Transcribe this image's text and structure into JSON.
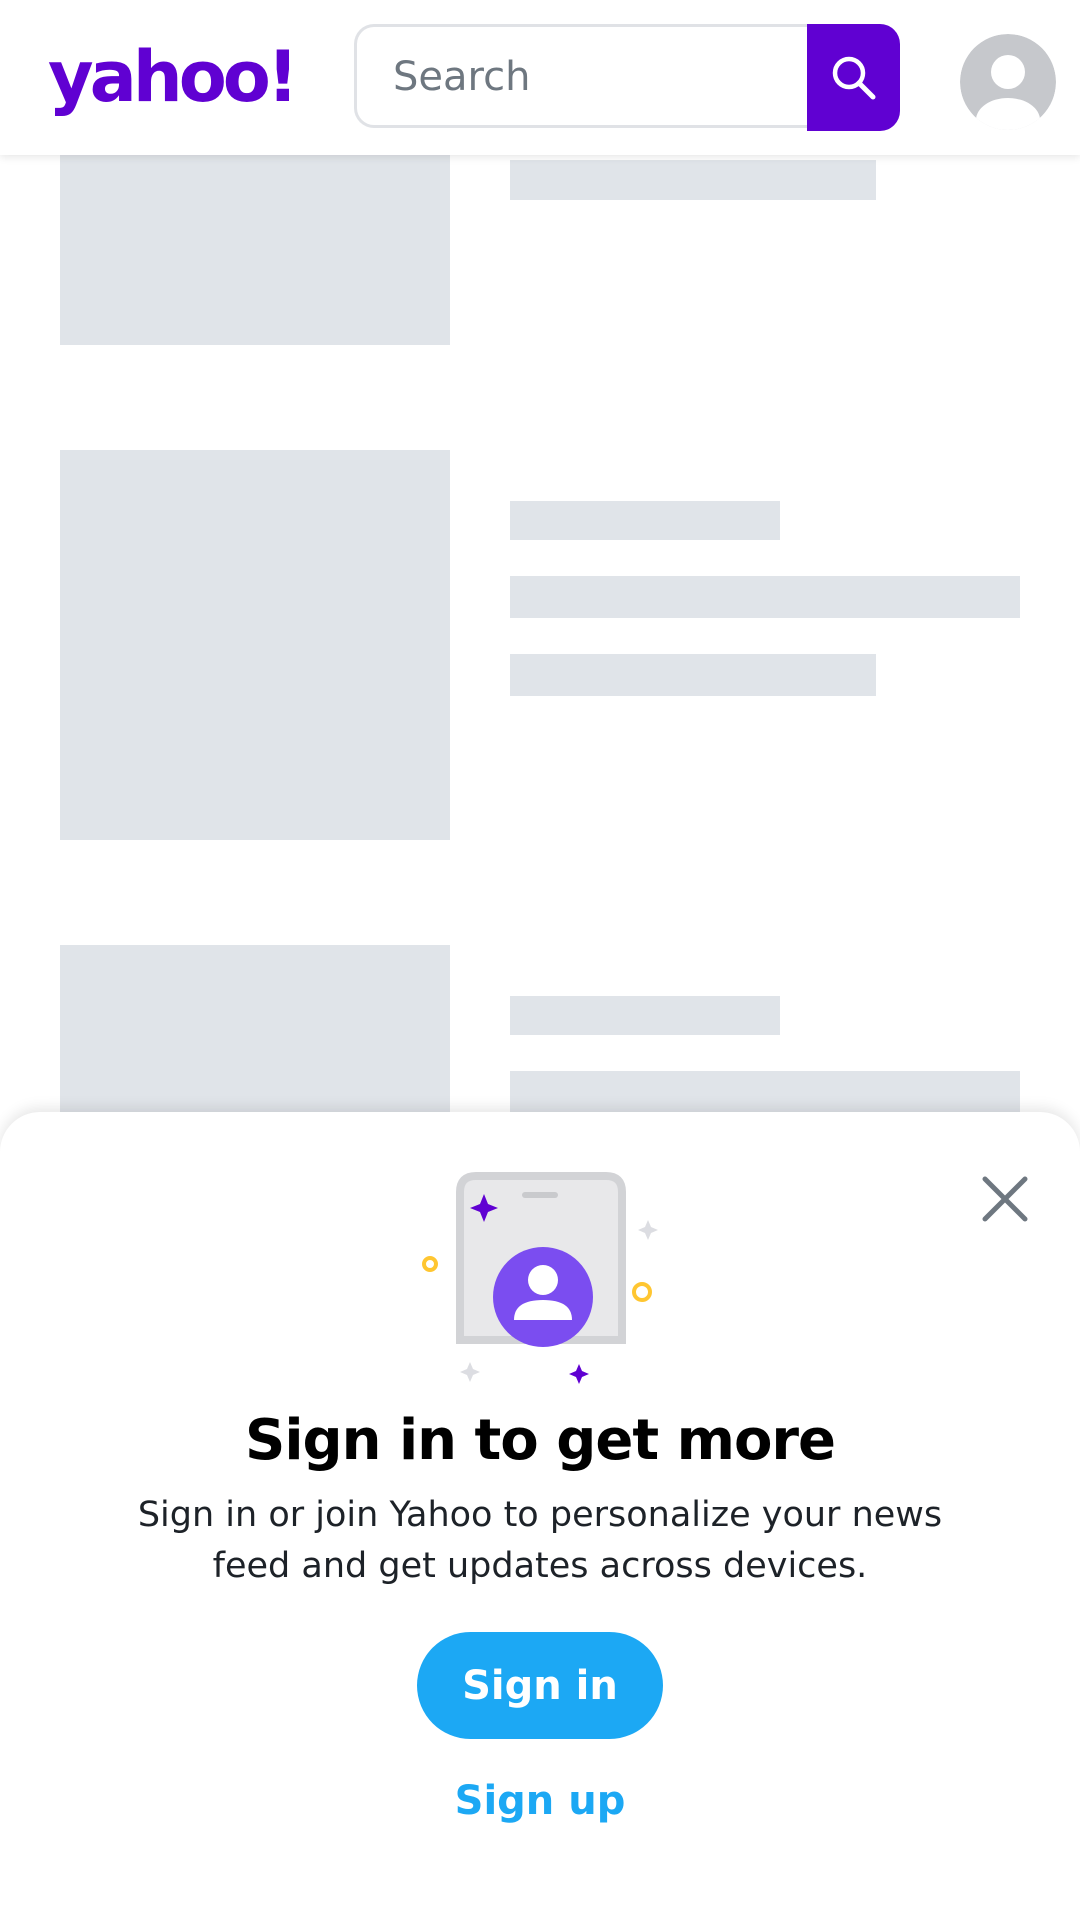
{
  "header": {
    "logo_text": "yahoo!",
    "search_placeholder": "Search",
    "brand_color": "#6001d2",
    "icons": {
      "search": "search-icon",
      "avatar": "user-avatar-icon"
    }
  },
  "feed": {
    "state": "loading-skeleton",
    "placeholder_color": "#e0e4e9"
  },
  "signin_sheet": {
    "title": "Sign in to get more",
    "description": "Sign in or join Yahoo to personalize your news feed and get updates across devices.",
    "signin_label": "Sign in",
    "signup_label": "Sign up",
    "accent_color": "#1ca8f4",
    "icons": {
      "close": "close-icon",
      "illustration": "phone-profile-illustration"
    }
  }
}
